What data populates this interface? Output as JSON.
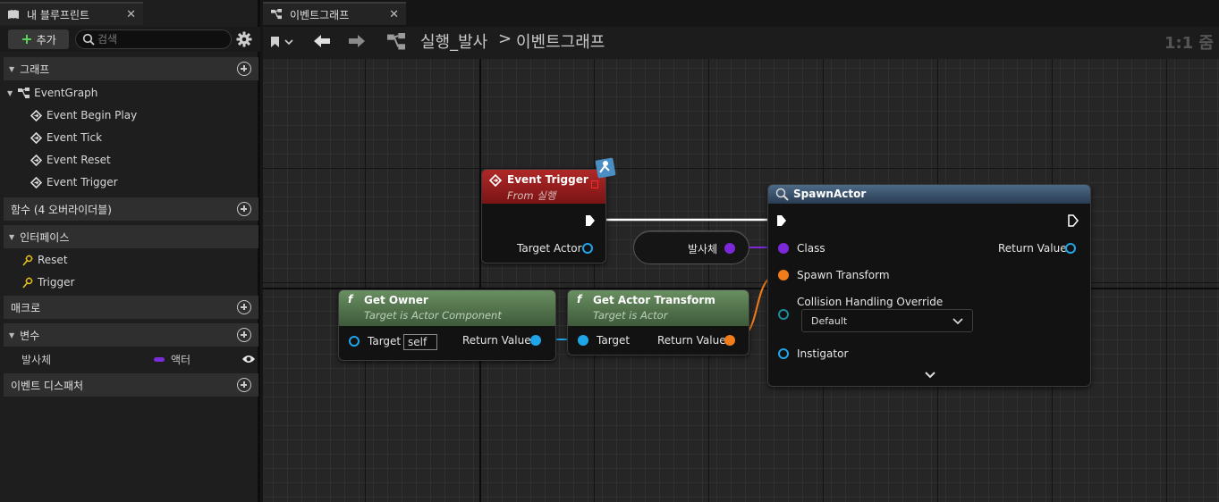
{
  "left_panel": {
    "tab_title": "내 블루프린트",
    "close_glyph": "✕",
    "add_button": "추가",
    "add_glyph": "+",
    "search_placeholder": "검색",
    "sections": {
      "graph": "그래프",
      "functions": "함수 (4 오버라이더블)",
      "interfaces": "인터페이스",
      "macros": "매크로",
      "variables": "변수",
      "event_dispatchers": "이벤트 디스패처"
    },
    "graph_items": {
      "event_graph": "EventGraph",
      "events": [
        "Event Begin Play",
        "Event Tick",
        "Event Reset",
        "Event Trigger"
      ]
    },
    "interface_items": [
      "Reset",
      "Trigger"
    ],
    "variables": [
      {
        "name": "발사체",
        "type": "액터",
        "type_color": "#7a2cd6"
      }
    ]
  },
  "graph_tab": {
    "title": "이벤트그래프",
    "close_glyph": "✕"
  },
  "header": {
    "breadcrumb_root": "실행_발사",
    "separator": ">",
    "breadcrumb_current": "이벤트그래프",
    "zoom": "1:1 줌"
  },
  "nodes": {
    "event_trigger": {
      "title": "Event Trigger",
      "subtitle": "From 실행",
      "pin_target_actor": "Target Actor",
      "header_color": "#8c1c1c"
    },
    "projectile_var": {
      "label": "발사체"
    },
    "spawn_actor": {
      "title": "SpawnActor",
      "pin_class": "Class",
      "pin_return": "Return Value",
      "pin_spawn_transform": "Spawn Transform",
      "pin_collision": "Collision Handling Override",
      "collision_value": "Default",
      "pin_instigator": "Instigator",
      "expand_glyph": "⌄"
    },
    "get_owner": {
      "title": "Get Owner",
      "subtitle": "Target is Actor Component",
      "pin_target": "Target",
      "target_value": "self",
      "pin_return": "Return Value"
    },
    "get_actor_transform": {
      "title": "Get Actor Transform",
      "subtitle": "Target is Actor",
      "pin_target": "Target",
      "pin_return": "Return Value"
    },
    "function_glyph": "f"
  }
}
